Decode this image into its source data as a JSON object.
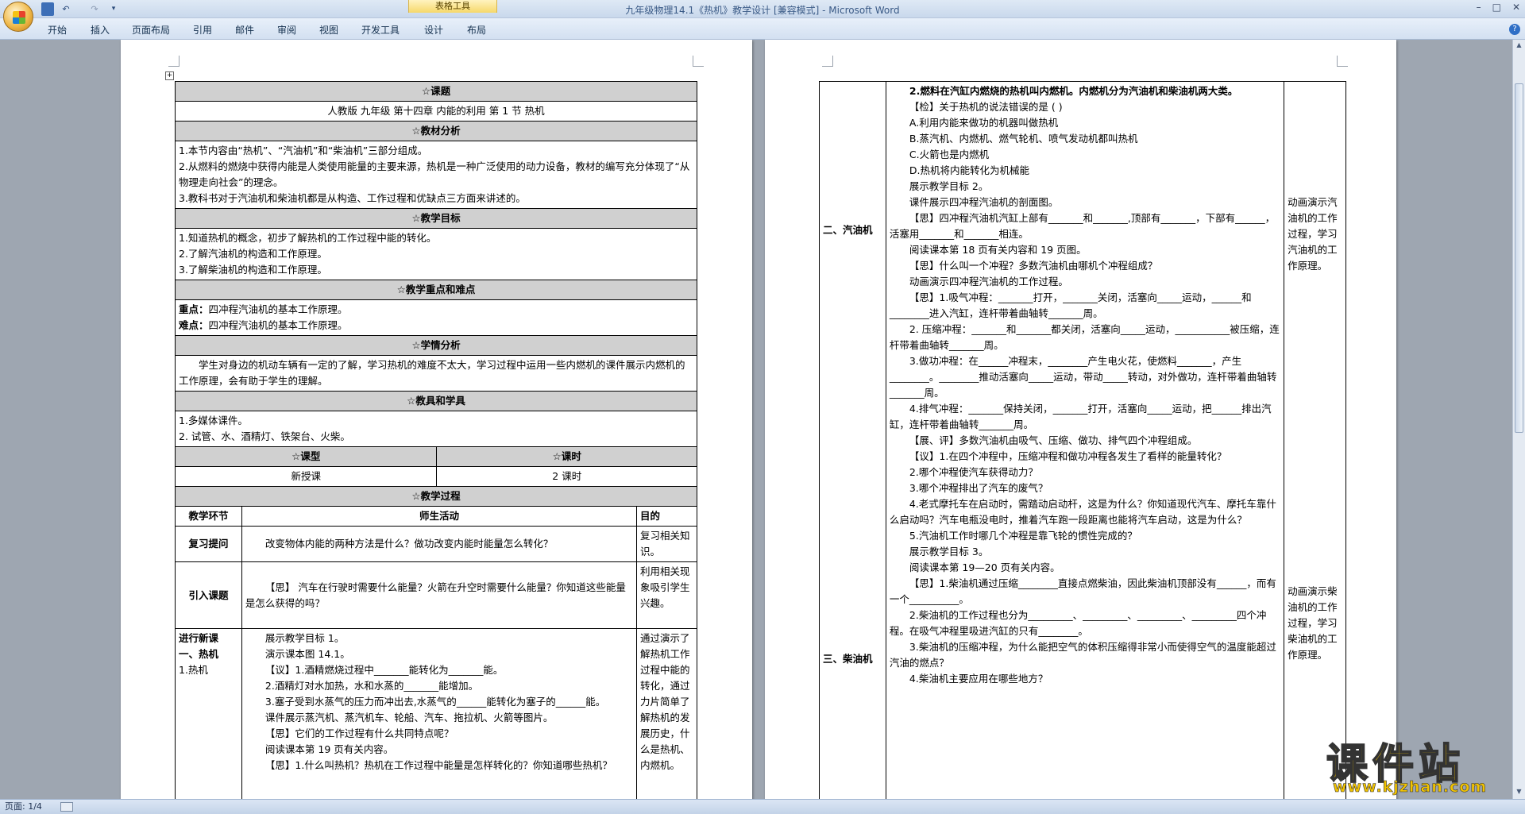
{
  "window": {
    "title": "九年级物理14.1《热机》教学设计 [兼容模式]",
    "app_name": "Microsoft Word",
    "table_tools": "表格工具",
    "controls": [
      "–",
      "□",
      "✕"
    ]
  },
  "ribbon": {
    "tabs": [
      "开始",
      "插入",
      "页面布局",
      "引用",
      "邮件",
      "审阅",
      "视图",
      "开发工具",
      "设计",
      "布局"
    ],
    "help": "?"
  },
  "status": {
    "page": "页面: 1/4"
  },
  "page1": {
    "topic_h": "☆课题",
    "topic": "人教版  九年级  第十四章    内能的利用    第 1 节  热机",
    "analysis_h": "☆教材分析",
    "analysis": [
      "1.本节内容由“热机”、“汽油机”和“柴油机”三部分组成。",
      "2.从燃料的燃烧中获得内能是人类使用能量的主要来源，热机是一种广泛使用的动力设备，教材的编写充分体现了“从物理走向社会”的理念。",
      "3.教科书对于汽油机和柴油机都是从构造、工作过程和优缺点三方面来讲述的。"
    ],
    "goals_h": "☆教学目标",
    "goals": [
      "1.知道热机的概念，初步了解热机的工作过程中能的转化。",
      "2.了解汽油机的构造和工作原理。",
      "3.了解柴油机的构造和工作原理。"
    ],
    "key_h": "☆教学重点和难点",
    "key_label": "重点：",
    "key": "四冲程汽油机的基本工作原理。",
    "diff_label": "难点：",
    "diff": "四冲程汽油机的基本工作原理。",
    "student_h": "☆学情分析",
    "student": "学生对身边的机动车辆有一定的了解，学习热机的难度不太大，学习过程中运用一些内燃机的课件展示内燃机的工作原理，会有助于学生的理解。",
    "tools_h": "☆教具和学具",
    "tools": [
      "1.多媒体课件。",
      "2. 试管、水、酒精灯、铁架台、火柴。"
    ],
    "type_h": "☆课型",
    "hours_h": "☆课时",
    "type": "新授课",
    "hours": "2 课时",
    "process_h": "☆教学过程",
    "col1": "教学环节",
    "col2": "师生活动",
    "col3": "目的",
    "row1_stage": "复习提问",
    "row1_act": "改变物体内能的两种方法是什么？做功改变内能时能量怎么转化？",
    "row1_purpose": "复习相关知识。",
    "row2_stage": "引入课题",
    "row2_act": "【思】 汽车在行驶时需要什么能量？火箭在升空时需要什么能量？你知道这些能量是怎么获得的吗？",
    "row2_purpose": "利用相关现象吸引学生兴趣。",
    "row3_stage": [
      "进行新课",
      "一、热机",
      "1.热机"
    ],
    "row3_act": [
      "展示教学目标 1。",
      "演示课本图 14.1。",
      "【议】1.酒精燃烧过程中_______能转化为_______能。",
      "2.酒精灯对水加热，水和水蒸的_______能增加。",
      "3.塞子受到水蒸气的压力而冲出去,水蒸气的______能转化为塞子的______能。",
      "课件展示蒸汽机、蒸汽机车、轮船、汽车、拖拉机、火箭等图片。",
      "【思】它们的工作过程有什么共同特点呢？",
      "阅读课本第 19 页有关内容。",
      "【思】1.什么叫热机？热机在工作过程中能量是怎样转化的？你知道哪些热机？"
    ],
    "row3_purpose": "通过演示了解热机工作过程中能的转化，通过力片简单了解热机的发展历史，什么是热机、内燃机。"
  },
  "page2": {
    "stage_gas": "二、汽油机",
    "stage_diesel": "三、柴油机",
    "lines": [
      "2.燃料在汽缸内燃烧的热机叫内燃机。内燃机分为汽油机和柴油机两大类。",
      "【检】关于热机的说法错误的是  (     )",
      "A.利用内能来做功的机器叫做热机",
      "B.蒸汽机、内燃机、燃气轮机、喷气发动机都叫热机",
      "C.火箭也是内燃机",
      "D.热机将内能转化为机械能",
      "展示教学目标 2。",
      "课件展示四冲程汽油机的剖面图。",
      "【思】四冲程汽油机汽缸上部有_______和_______,顶部有_______，下部有______，活塞用_______和_______相连。",
      "阅读课本第 18 页有关内容和 19 页图。",
      "【思】什么叫一个冲程？多数汽油机由哪机个冲程组成？",
      "动画演示四冲程汽油机的工作过程。",
      "【思】1.吸气冲程：_______打开，_______关闭，活塞向_____运动，______和________进入汽缸，连杆带着曲轴转_______周。",
      "2. 压缩冲程：_______和_______都关闭，活塞向_____运动，___________被压缩，连杆带着曲轴转_______周。",
      "3.做功冲程：在______冲程末，________产生电火花，使燃料_______，产生________。________推动活塞向_____运动，带动_____转动，对外做功，连杆带着曲轴转_______周。",
      "4.排气冲程：_______保持关闭，_______打开，活塞向_____运动，把______排出汽缸，连杆带着曲轴转_______周。",
      "【展、评】多数汽油机由吸气、压缩、做功、排气四个冲程组成。",
      "【议】1.在四个冲程中，压缩冲程和做功冲程各发生了看样的能量转化？",
      "2.哪个冲程使汽车获得动力？",
      "3.哪个冲程排出了汽车的废气？",
      "4.老式摩托车在启动时，需踏动启动杆，这是为什么？你知道现代汽车、摩托车靠什么启动吗？汽车电瓶没电时，推着汽车跑一段距离也能将汽车启动，这是为什么？",
      "5.汽油机工作时哪几个冲程是靠飞轮的惯性完成的？",
      "展示教学目标 3。",
      "阅读课本第 19—20 页有关内容。",
      "【思】1.柴油机通过压缩________直接点燃柴油，因此柴油机顶部没有______，而有一个__________。",
      "2.柴油机的工作过程也分为_________、_________、_________、_________四个冲程。在吸气冲程里吸进汽缸的只有________。",
      "3.柴油机的压缩冲程，为什么能把空气的体积压缩得非常小而使得空气的温度能超过汽油的燃点？",
      "4.柴油机主要应用在哪些地方？"
    ],
    "purpose_gas": "动画演示汽油机的工作过程，学习汽油机的工作原理。",
    "purpose_diesel": "动画演示柴油机的工作过程，学习柴油机的工作原理。"
  },
  "watermark": {
    "text": "课件站",
    "url": "www.kjzhan.com"
  }
}
